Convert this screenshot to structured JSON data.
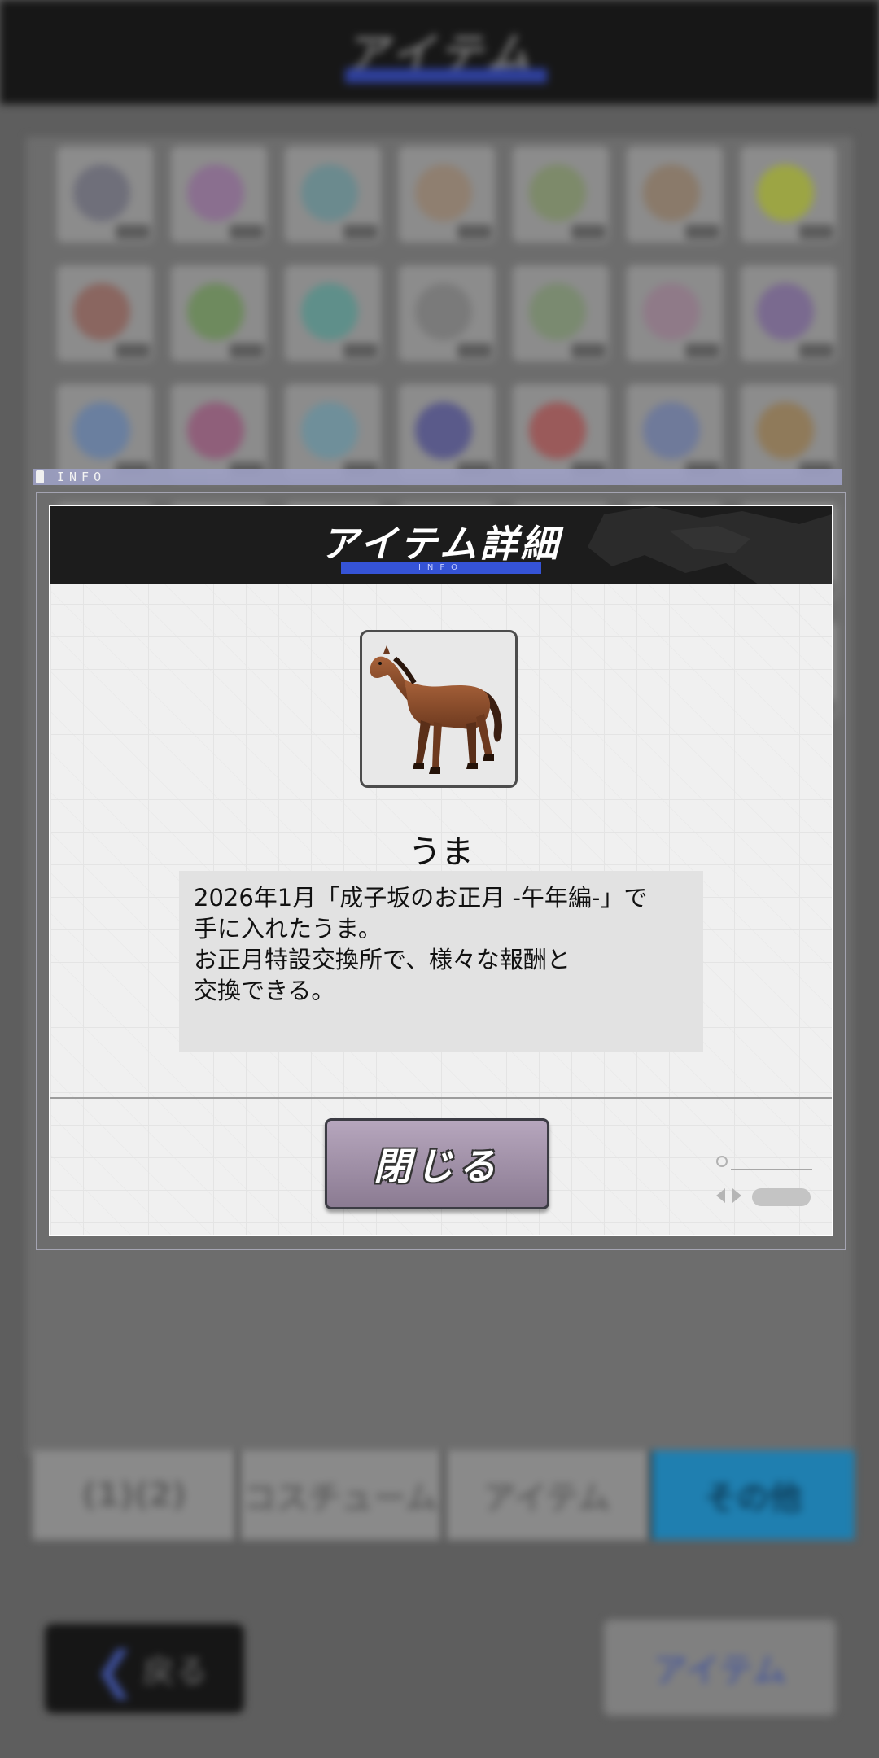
{
  "background": {
    "screen_title": "アイテム",
    "tabs": [
      {
        "label": "(1)(2)",
        "active": false
      },
      {
        "label": "コスチューム",
        "active": false
      },
      {
        "label": "アイテム",
        "active": false
      },
      {
        "label": "その他",
        "active": true
      }
    ],
    "back_label": "戻る",
    "right_button_label": "アイテム"
  },
  "info_strip": {
    "label": "INFO"
  },
  "modal": {
    "title": "アイテム詳細",
    "subtitle": "INFO",
    "item": {
      "name": "うま",
      "icon": "horse-icon",
      "description": [
        "2026年1月「成子坂のお正月 -午年編-」で",
        "手に入れたうま。",
        "お正月特設交換所で、様々な報酬と",
        "交換できる。"
      ]
    },
    "close_label": "閉じる"
  },
  "colors": {
    "header_bg": "#1c1c1c",
    "title_accent": "#3553d6",
    "close_button": "#a796ad",
    "modal_bg": "#f0f0f0",
    "description_bg": "#e2e2e2"
  }
}
